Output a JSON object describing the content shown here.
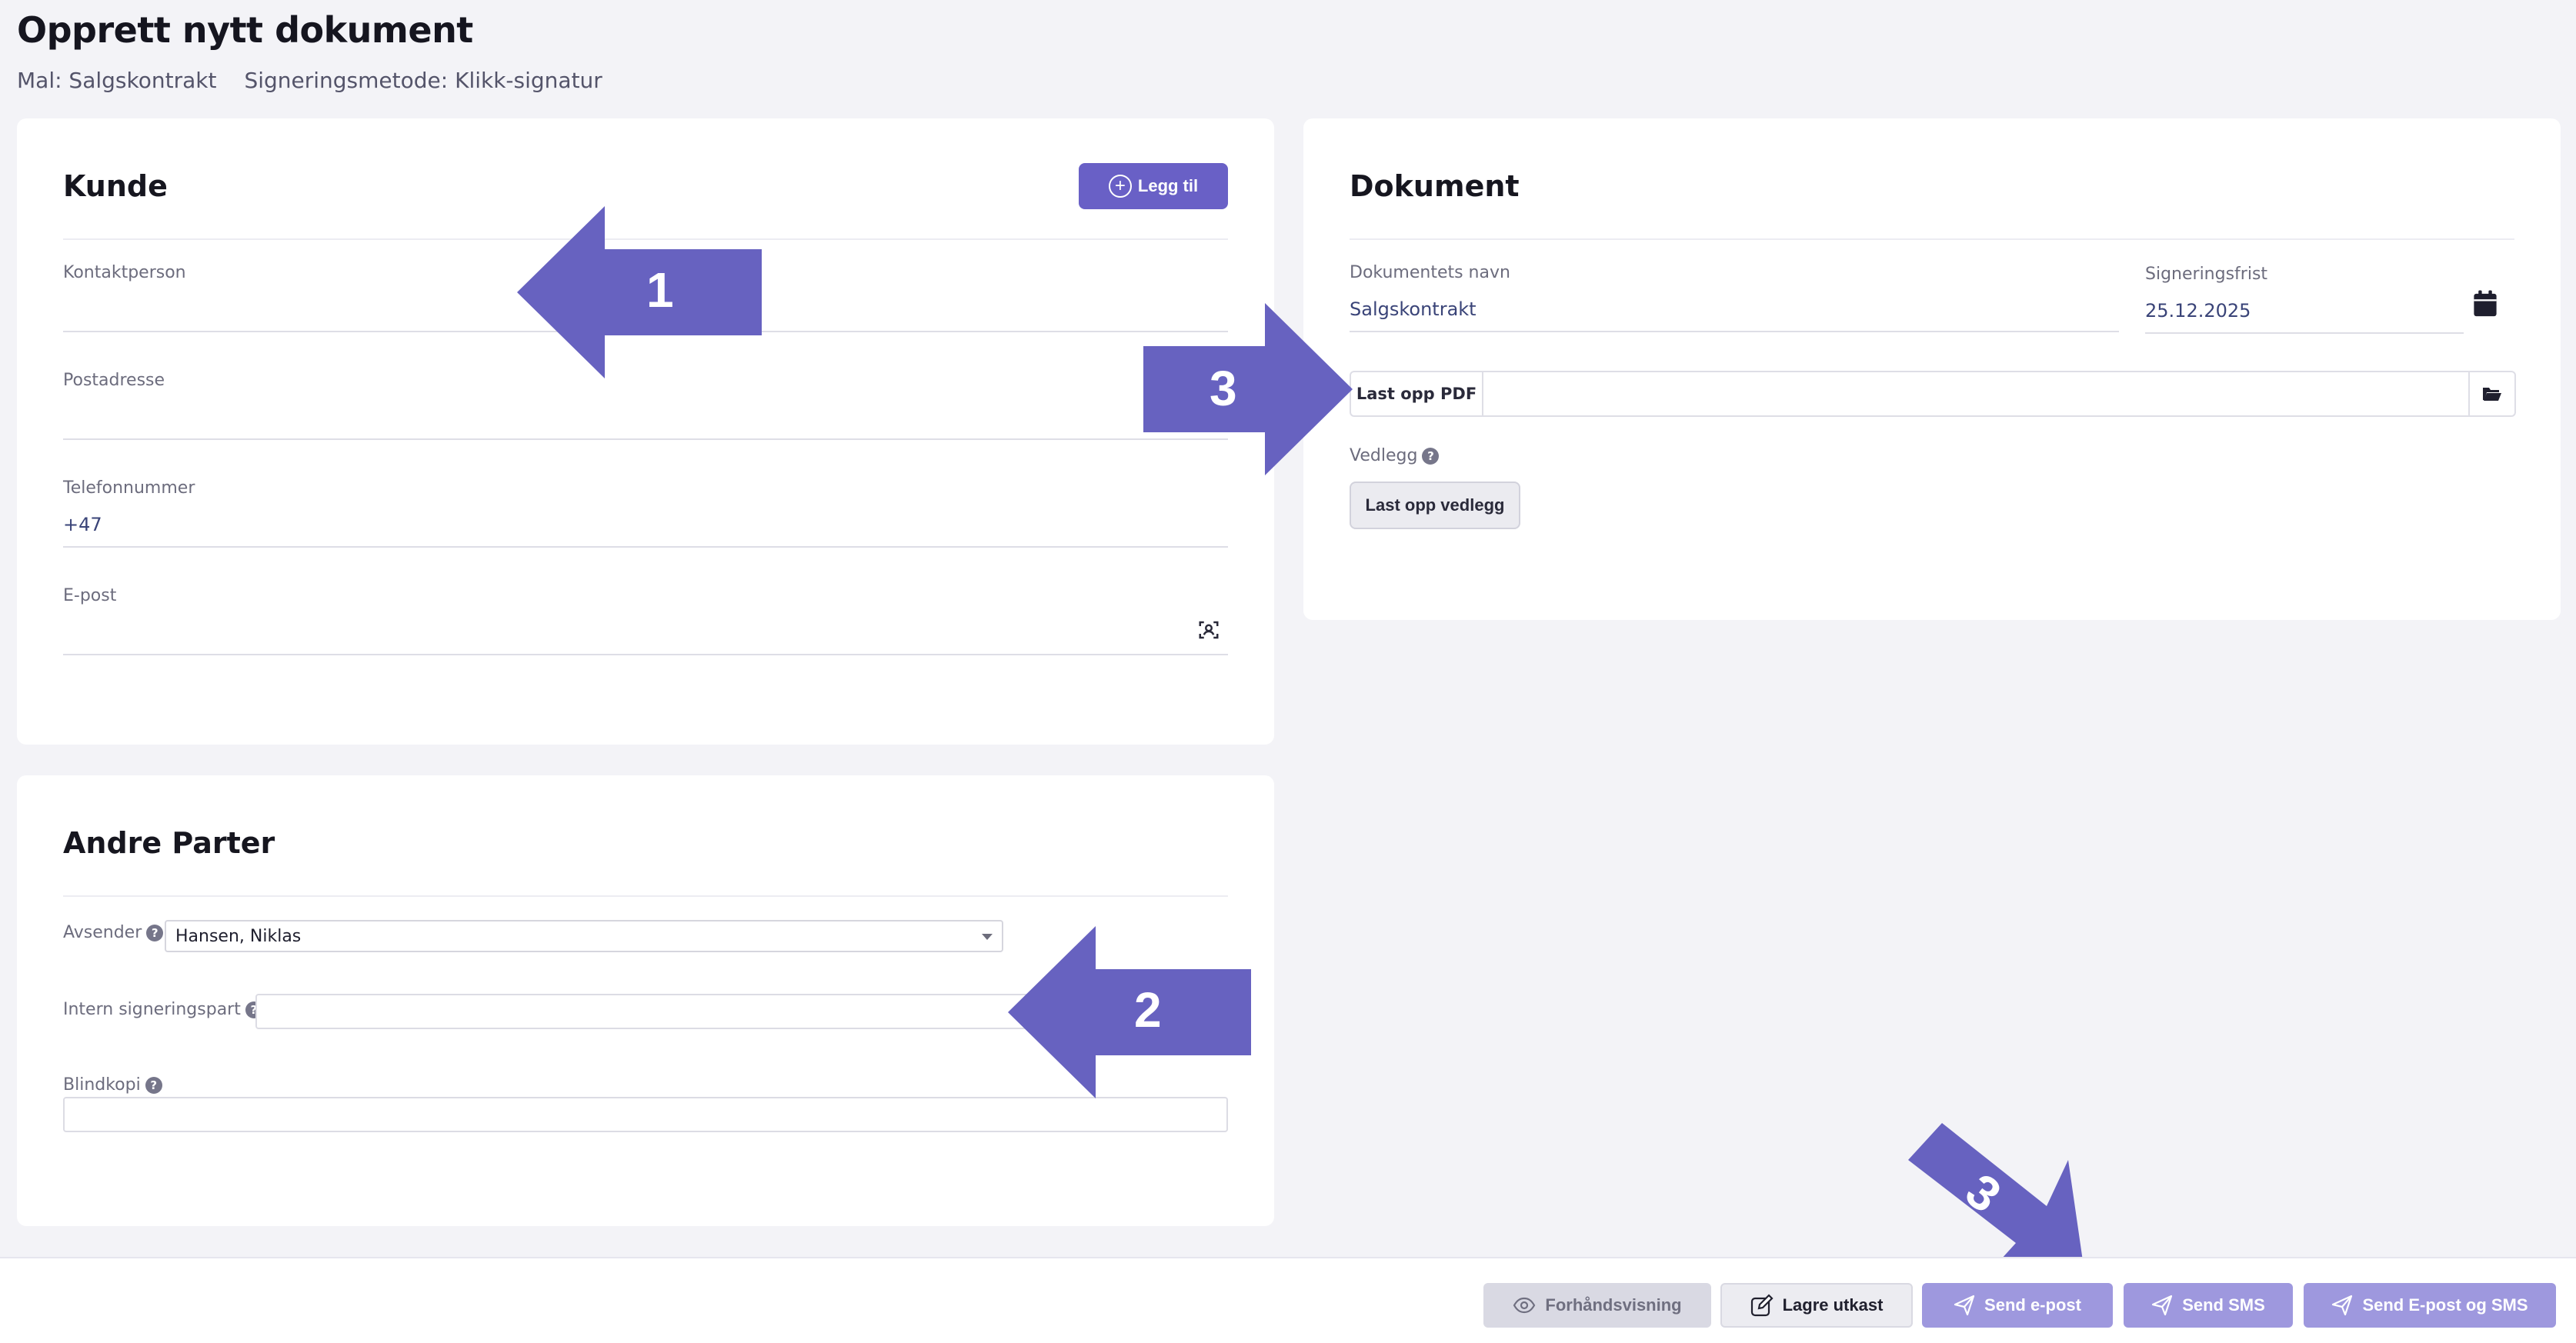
{
  "header": {
    "title": "Opprett nytt dokument",
    "template": "Mal: Salgskontrakt",
    "signing_method": "Signeringsmetode: Klikk-signatur"
  },
  "kunde": {
    "title": "Kunde",
    "add_label": "Legg til",
    "fields": [
      {
        "label": "Kontaktperson",
        "value": ""
      },
      {
        "label": "Postadresse",
        "value": ""
      },
      {
        "label": "Telefonnummer",
        "value": "+47"
      },
      {
        "label": "E-post",
        "value": ""
      }
    ]
  },
  "andre_parter": {
    "title": "Andre Parter",
    "sender_label": "Avsender",
    "sender_value": "Hansen, Niklas",
    "internal_label": "Intern signeringspart",
    "bcc_label": "Blindkopi"
  },
  "dokument": {
    "title": "Dokument",
    "name_label": "Dokumentets navn",
    "name_value": "Salgskontrakt",
    "deadline_label": "Signeringsfrist",
    "deadline_value": "25.12.2025",
    "upload_pdf_label": "Last opp PDF",
    "attachment_label": "Vedlegg",
    "upload_attachment_label": "Last opp vedlegg"
  },
  "footer": {
    "preview": "Forhåndsvisning",
    "save_draft": "Lagre utkast",
    "send_email": "Send e-post",
    "send_sms": "Send SMS",
    "send_both": "Send E-post og SMS"
  },
  "annotations": {
    "arrow1": "1",
    "arrow2": "2",
    "arrow3a": "3",
    "arrow3b": "3",
    "color": "#6762c0"
  },
  "icons": {
    "add": "plus-circle-icon",
    "scan": "scan-icon",
    "calendar": "calendar-icon",
    "folder": "folder-icon",
    "help": "help-icon",
    "eye": "eye-icon",
    "edit": "edit-icon",
    "send": "send-icon"
  }
}
